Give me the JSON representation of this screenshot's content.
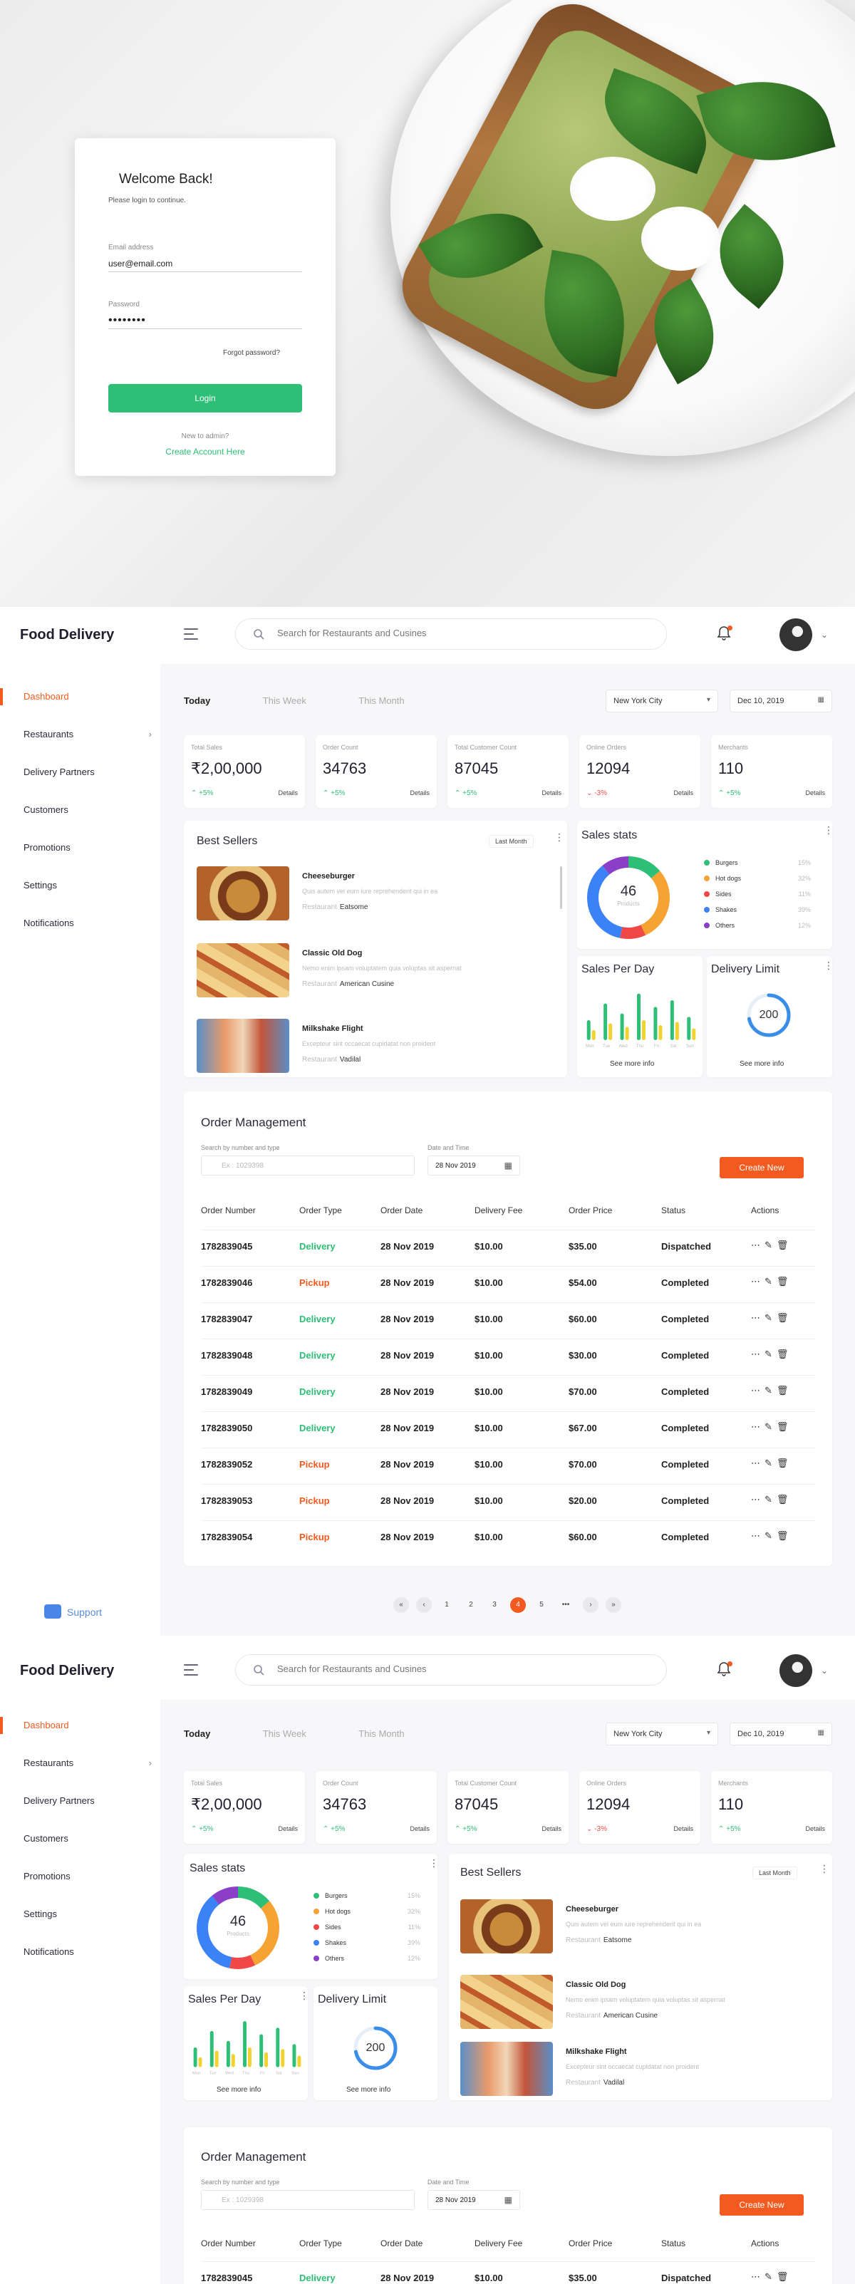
{
  "login": {
    "title": "Welcome Back!",
    "subtitle": "Please login to continue.",
    "email_label": "Email address",
    "email_value": "user@email.com",
    "password_label": "Password",
    "password_value": "••••••••",
    "forgot": "Forgot password?",
    "login_button": "Login",
    "new_to_admin": "New to admin?",
    "create_account": "Create Account Here"
  },
  "app": {
    "brand": "Food Delivery",
    "search_placeholder": "Search for Restaurants and Cusines",
    "nav": [
      "Dashboard",
      "Restaurants",
      "Delivery Partners",
      "Customers",
      "Promotions",
      "Settings",
      "Notifications"
    ],
    "support": "Support",
    "periods": [
      "Today",
      "This Week",
      "This Month"
    ],
    "city": "New York City",
    "date": "Dec 10, 2019",
    "stats": [
      {
        "title": "Total Sales",
        "value": "₹2,00,000",
        "delta": "+5%",
        "trend": "up",
        "details": "Details"
      },
      {
        "title": "Order Count",
        "value": "34763",
        "delta": "+5%",
        "trend": "up",
        "details": "Details"
      },
      {
        "title": "Total Customer Count",
        "value": "87045",
        "delta": "+5%",
        "trend": "up",
        "details": "Details"
      },
      {
        "title": "Online Orders",
        "value": "12094",
        "delta": "-3%",
        "trend": "down",
        "details": "Details"
      },
      {
        "title": "Merchants",
        "value": "110",
        "delta": "+5%",
        "trend": "up",
        "details": "Details"
      }
    ]
  },
  "best_sellers": {
    "title": "Best Sellers",
    "filter": "Last Month",
    "items": [
      {
        "name": "Cheeseburger",
        "desc": "Quis autem vel eum iure reprehenderit qui in ea",
        "restaurant_label": "Restaurant",
        "restaurant": "Eatsome"
      },
      {
        "name": "Classic Old Dog",
        "desc": "Nemo enim ipsam voluptatem quia voluptas sit aspernat",
        "restaurant_label": "Restaurant",
        "restaurant": "American Cusine"
      },
      {
        "name": "Milkshake Flight",
        "desc": "Excepteur sint occaecat cupidatat non proident",
        "restaurant_label": "Restaurant",
        "restaurant": "Vadilal"
      }
    ]
  },
  "sales_stats": {
    "title": "Sales stats",
    "center_value": "46",
    "center_label": "Products",
    "legend": [
      {
        "label": "Burgers",
        "pct": "15%",
        "color": "#2dbf76"
      },
      {
        "label": "Hot dogs",
        "pct": "32%",
        "color": "#f7a334"
      },
      {
        "label": "Sides",
        "pct": "11%",
        "color": "#f04747"
      },
      {
        "label": "Shakes",
        "pct": "39%",
        "color": "#3b82f6"
      },
      {
        "label": "Others",
        "pct": "12%",
        "color": "#8b3fc9"
      }
    ]
  },
  "chart_data": {
    "type": "bar",
    "categories": [
      "Mon",
      "Tue",
      "Wed",
      "Thu",
      "Fri",
      "Sat",
      "Sun"
    ],
    "series": [
      {
        "values": [
          12,
          22,
          16,
          28,
          20,
          24,
          14
        ],
        "color": "#2dbf76"
      },
      {
        "values": [
          6,
          10,
          8,
          12,
          9,
          11,
          7
        ],
        "color": "#f2d22e"
      }
    ],
    "title": "Sales Per Day"
  },
  "sales_per_day": {
    "title": "Sales Per Day",
    "more": "See more info"
  },
  "delivery_limit": {
    "title": "Delivery Limit",
    "value": "200",
    "fill": 0.72,
    "more": "See more info"
  },
  "orders": {
    "title": "Order Management",
    "search_label": "Search by number and type",
    "search_placeholder": "Ex : 1029398",
    "date_label": "Date and Time",
    "date_value": "28 Nov 2019",
    "create": "Create New",
    "columns": [
      "Order Number",
      "Order Type",
      "Order Date",
      "Delivery Fee",
      "Order Price",
      "Status",
      "Actions"
    ],
    "rows": [
      [
        "1782839045",
        "Delivery",
        "28 Nov 2019",
        "$10.00",
        "$35.00",
        "Dispatched"
      ],
      [
        "1782839046",
        "Pickup",
        "28 Nov 2019",
        "$10.00",
        "$54.00",
        "Completed"
      ],
      [
        "1782839047",
        "Delivery",
        "28 Nov 2019",
        "$10.00",
        "$60.00",
        "Completed"
      ],
      [
        "1782839048",
        "Delivery",
        "28 Nov 2019",
        "$10.00",
        "$30.00",
        "Completed"
      ],
      [
        "1782839049",
        "Delivery",
        "28 Nov 2019",
        "$10.00",
        "$70.00",
        "Completed"
      ],
      [
        "1782839050",
        "Delivery",
        "28 Nov 2019",
        "$10.00",
        "$67.00",
        "Completed"
      ],
      [
        "1782839052",
        "Pickup",
        "28 Nov 2019",
        "$10.00",
        "$70.00",
        "Completed"
      ],
      [
        "1782839053",
        "Pickup",
        "28 Nov 2019",
        "$10.00",
        "$20.00",
        "Completed"
      ],
      [
        "1782839054",
        "Pickup",
        "28 Nov 2019",
        "$10.00",
        "$60.00",
        "Completed"
      ]
    ]
  },
  "pagination": {
    "pages": [
      "1",
      "2",
      "3",
      "4",
      "5",
      "•••"
    ],
    "current": "4"
  }
}
